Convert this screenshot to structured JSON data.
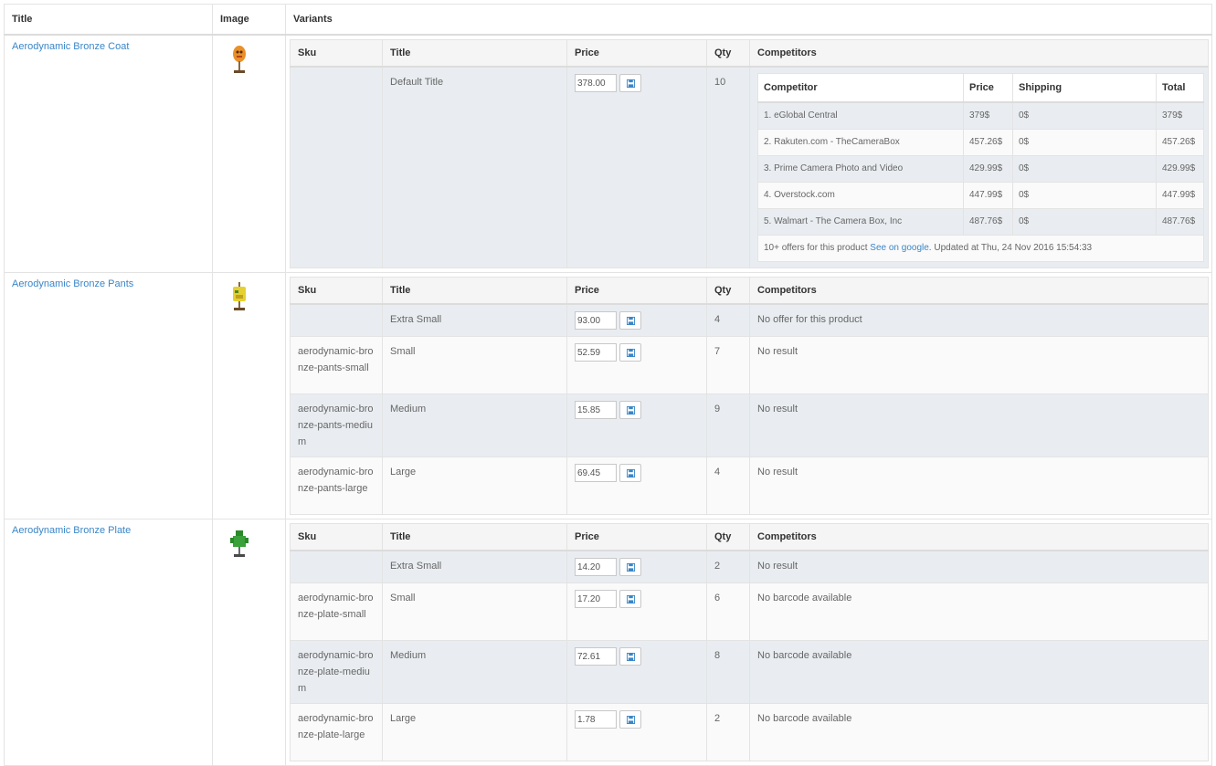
{
  "headers": {
    "title": "Title",
    "image": "Image",
    "variants": "Variants"
  },
  "variant_headers": {
    "sku": "Sku",
    "title": "Title",
    "price": "Price",
    "qty": "Qty",
    "competitors": "Competitors"
  },
  "competitor_headers": {
    "competitor": "Competitor",
    "price": "Price",
    "shipping": "Shipping",
    "total": "Total"
  },
  "products": [
    {
      "name": "Aerodynamic Bronze Coat",
      "image_icon": "orange-figure-icon",
      "variants": [
        {
          "sku": "",
          "title": "Default Title",
          "price": "378.00",
          "qty": "10",
          "competitors": [
            {
              "name": "1. eGlobal Central",
              "price": "379$",
              "shipping": "0$",
              "total": "379$"
            },
            {
              "name": "2. Rakuten.com - TheCameraBox",
              "price": "457.26$",
              "shipping": "0$",
              "total": "457.26$"
            },
            {
              "name": "3. Prime Camera Photo and Video",
              "price": "429.99$",
              "shipping": "0$",
              "total": "429.99$"
            },
            {
              "name": "4. Overstock.com",
              "price": "447.99$",
              "shipping": "0$",
              "total": "447.99$"
            },
            {
              "name": "5. Walmart - The Camera Box, Inc",
              "price": "487.76$",
              "shipping": "0$",
              "total": "487.76$"
            }
          ],
          "footer": {
            "prefix": "10+ offers for this product ",
            "link": "See on google",
            "suffix": ". Updated at Thu, 24 Nov 2016 15:54:33"
          }
        }
      ]
    },
    {
      "name": "Aerodynamic Bronze Pants",
      "image_icon": "yellow-figure-icon",
      "variants": [
        {
          "sku": "",
          "title": "Extra Small",
          "price": "93.00",
          "qty": "4",
          "status": "No offer for this product"
        },
        {
          "sku": "aerodynamic-bronze-pants-small",
          "title": "Small",
          "price": "52.59",
          "qty": "7",
          "status": "No result"
        },
        {
          "sku": "aerodynamic-bronze-pants-medium",
          "title": "Medium",
          "price": "15.85",
          "qty": "9",
          "status": "No result"
        },
        {
          "sku": "aerodynamic-bronze-pants-large",
          "title": "Large",
          "price": "69.45",
          "qty": "4",
          "status": "No result"
        }
      ]
    },
    {
      "name": "Aerodynamic Bronze Plate",
      "image_icon": "green-figure-icon",
      "variants": [
        {
          "sku": "",
          "title": "Extra Small",
          "price": "14.20",
          "qty": "2",
          "status": "No result"
        },
        {
          "sku": "aerodynamic-bronze-plate-small",
          "title": "Small",
          "price": "17.20",
          "qty": "6",
          "status": "No barcode available"
        },
        {
          "sku": "aerodynamic-bronze-plate-medium",
          "title": "Medium",
          "price": "72.61",
          "qty": "8",
          "status": "No barcode available"
        },
        {
          "sku": "aerodynamic-bronze-plate-large",
          "title": "Large",
          "price": "1.78",
          "qty": "2",
          "status": "No barcode available"
        }
      ]
    }
  ],
  "colors": {
    "link": "#3a86c8",
    "row_stripe": "#e9edf1",
    "border": "#e3e3e3"
  }
}
